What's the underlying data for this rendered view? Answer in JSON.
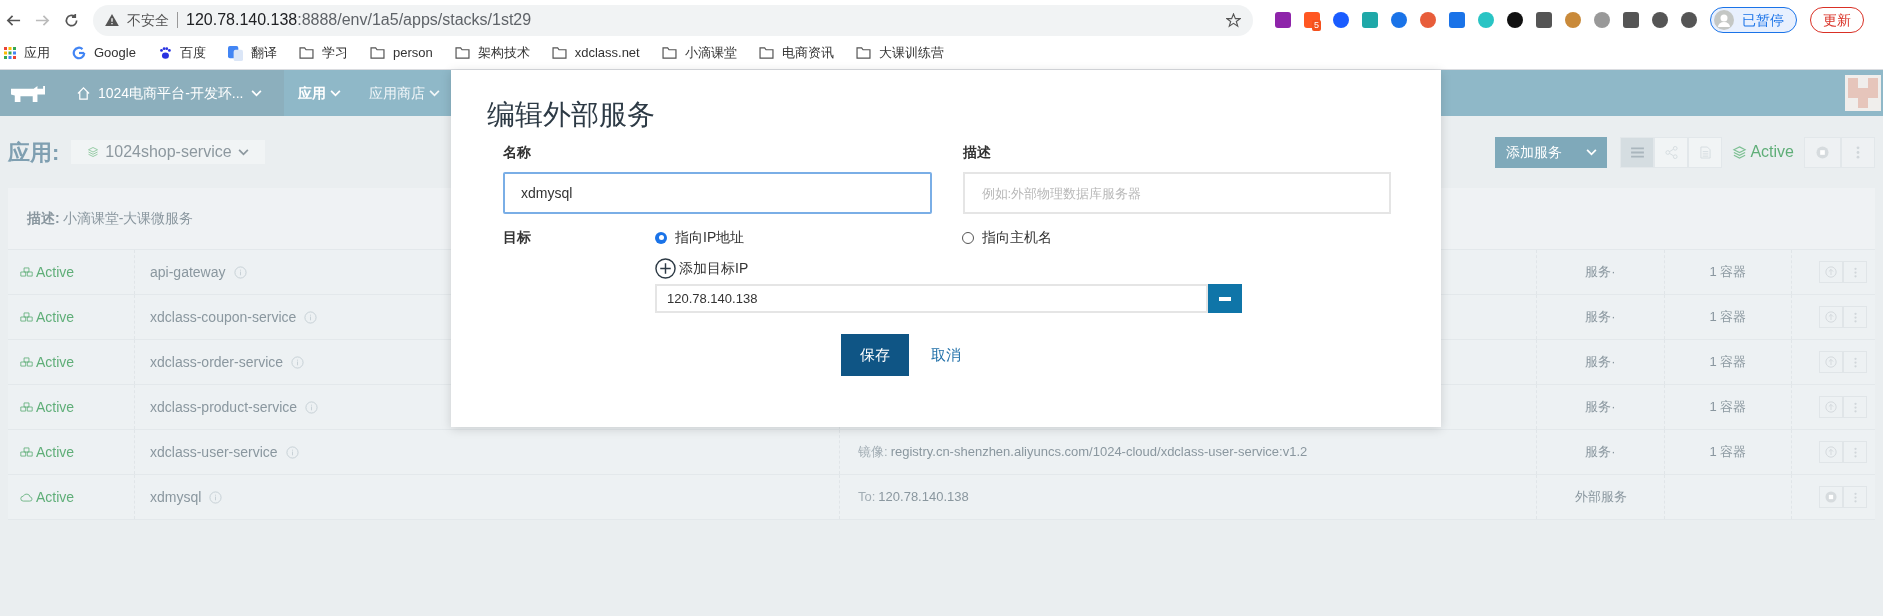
{
  "browser": {
    "security": "不安全",
    "host": "120.78.140.138",
    "path": ":8888/env/1a5/apps/stacks/1st29",
    "extension_badge": "5",
    "profile": "已暂停",
    "update": "更新",
    "bookmarks": [
      {
        "kind": "apps",
        "label": "应用"
      },
      {
        "kind": "google",
        "label": "Google"
      },
      {
        "kind": "baidu",
        "label": "百度"
      },
      {
        "kind": "translate",
        "label": "翻译"
      },
      {
        "kind": "folder",
        "label": "学习"
      },
      {
        "kind": "folder",
        "label": "person"
      },
      {
        "kind": "folder",
        "label": "架构技术"
      },
      {
        "kind": "folder",
        "label": "xdclass.net"
      },
      {
        "kind": "folder",
        "label": "小滴课堂"
      },
      {
        "kind": "folder",
        "label": "电商资讯"
      },
      {
        "kind": "folder",
        "label": "大课训练营"
      }
    ]
  },
  "nav": {
    "environment": "1024电商平台-开发环...",
    "items": [
      {
        "label": "应用",
        "selected": true
      },
      {
        "label": "应用商店",
        "selected": false
      }
    ]
  },
  "header": {
    "title": "应用:",
    "stack": "1024shop-service",
    "add_button": "添加服务",
    "views": [
      {
        "kind": "list",
        "selected": true
      },
      {
        "kind": "graph",
        "selected": false
      },
      {
        "kind": "file",
        "selected": false
      }
    ],
    "state": "Active"
  },
  "description": {
    "label": "描述:",
    "text": "小滴课堂-大课微服务"
  },
  "rows": [
    {
      "kind": "service",
      "state": "Active",
      "name": "api-gateway",
      "type": "服务·",
      "scale": "1 容器"
    },
    {
      "kind": "service",
      "state": "Active",
      "name": "xdclass-coupon-service",
      "type": "服务·",
      "scale": "1 容器"
    },
    {
      "kind": "service",
      "state": "Active",
      "name": "xdclass-order-service",
      "type": "服务·",
      "scale": "1 容器"
    },
    {
      "kind": "service",
      "state": "Active",
      "name": "xdclass-product-service",
      "type": "服务·",
      "scale": "1 容器"
    },
    {
      "kind": "service",
      "state": "Active",
      "name": "xdclass-user-service",
      "detail_label": "镜像:",
      "detail": "registry.cn-shenzhen.aliyuncs.com/1024-cloud/xdclass-user-service:v1.2",
      "type": "服务·",
      "scale": "1 容器"
    },
    {
      "kind": "external",
      "state": "Active",
      "name": "xdmysql",
      "detail_label": "To:",
      "detail": "120.78.140.138",
      "type": "外部服务"
    }
  ],
  "modal": {
    "title": "编辑外部服务",
    "name_label": "名称",
    "name_value": "xdmysql",
    "desc_label": "描述",
    "desc_placeholder": "例如:外部物理数据库服务器",
    "target_label": "目标",
    "targets": [
      {
        "label": "指向IP地址",
        "selected": true
      },
      {
        "label": "指向主机名",
        "selected": false
      }
    ],
    "add_ip": "添加目标IP",
    "ips": [
      "120.78.140.138"
    ],
    "save": "保存",
    "cancel": "取消"
  }
}
